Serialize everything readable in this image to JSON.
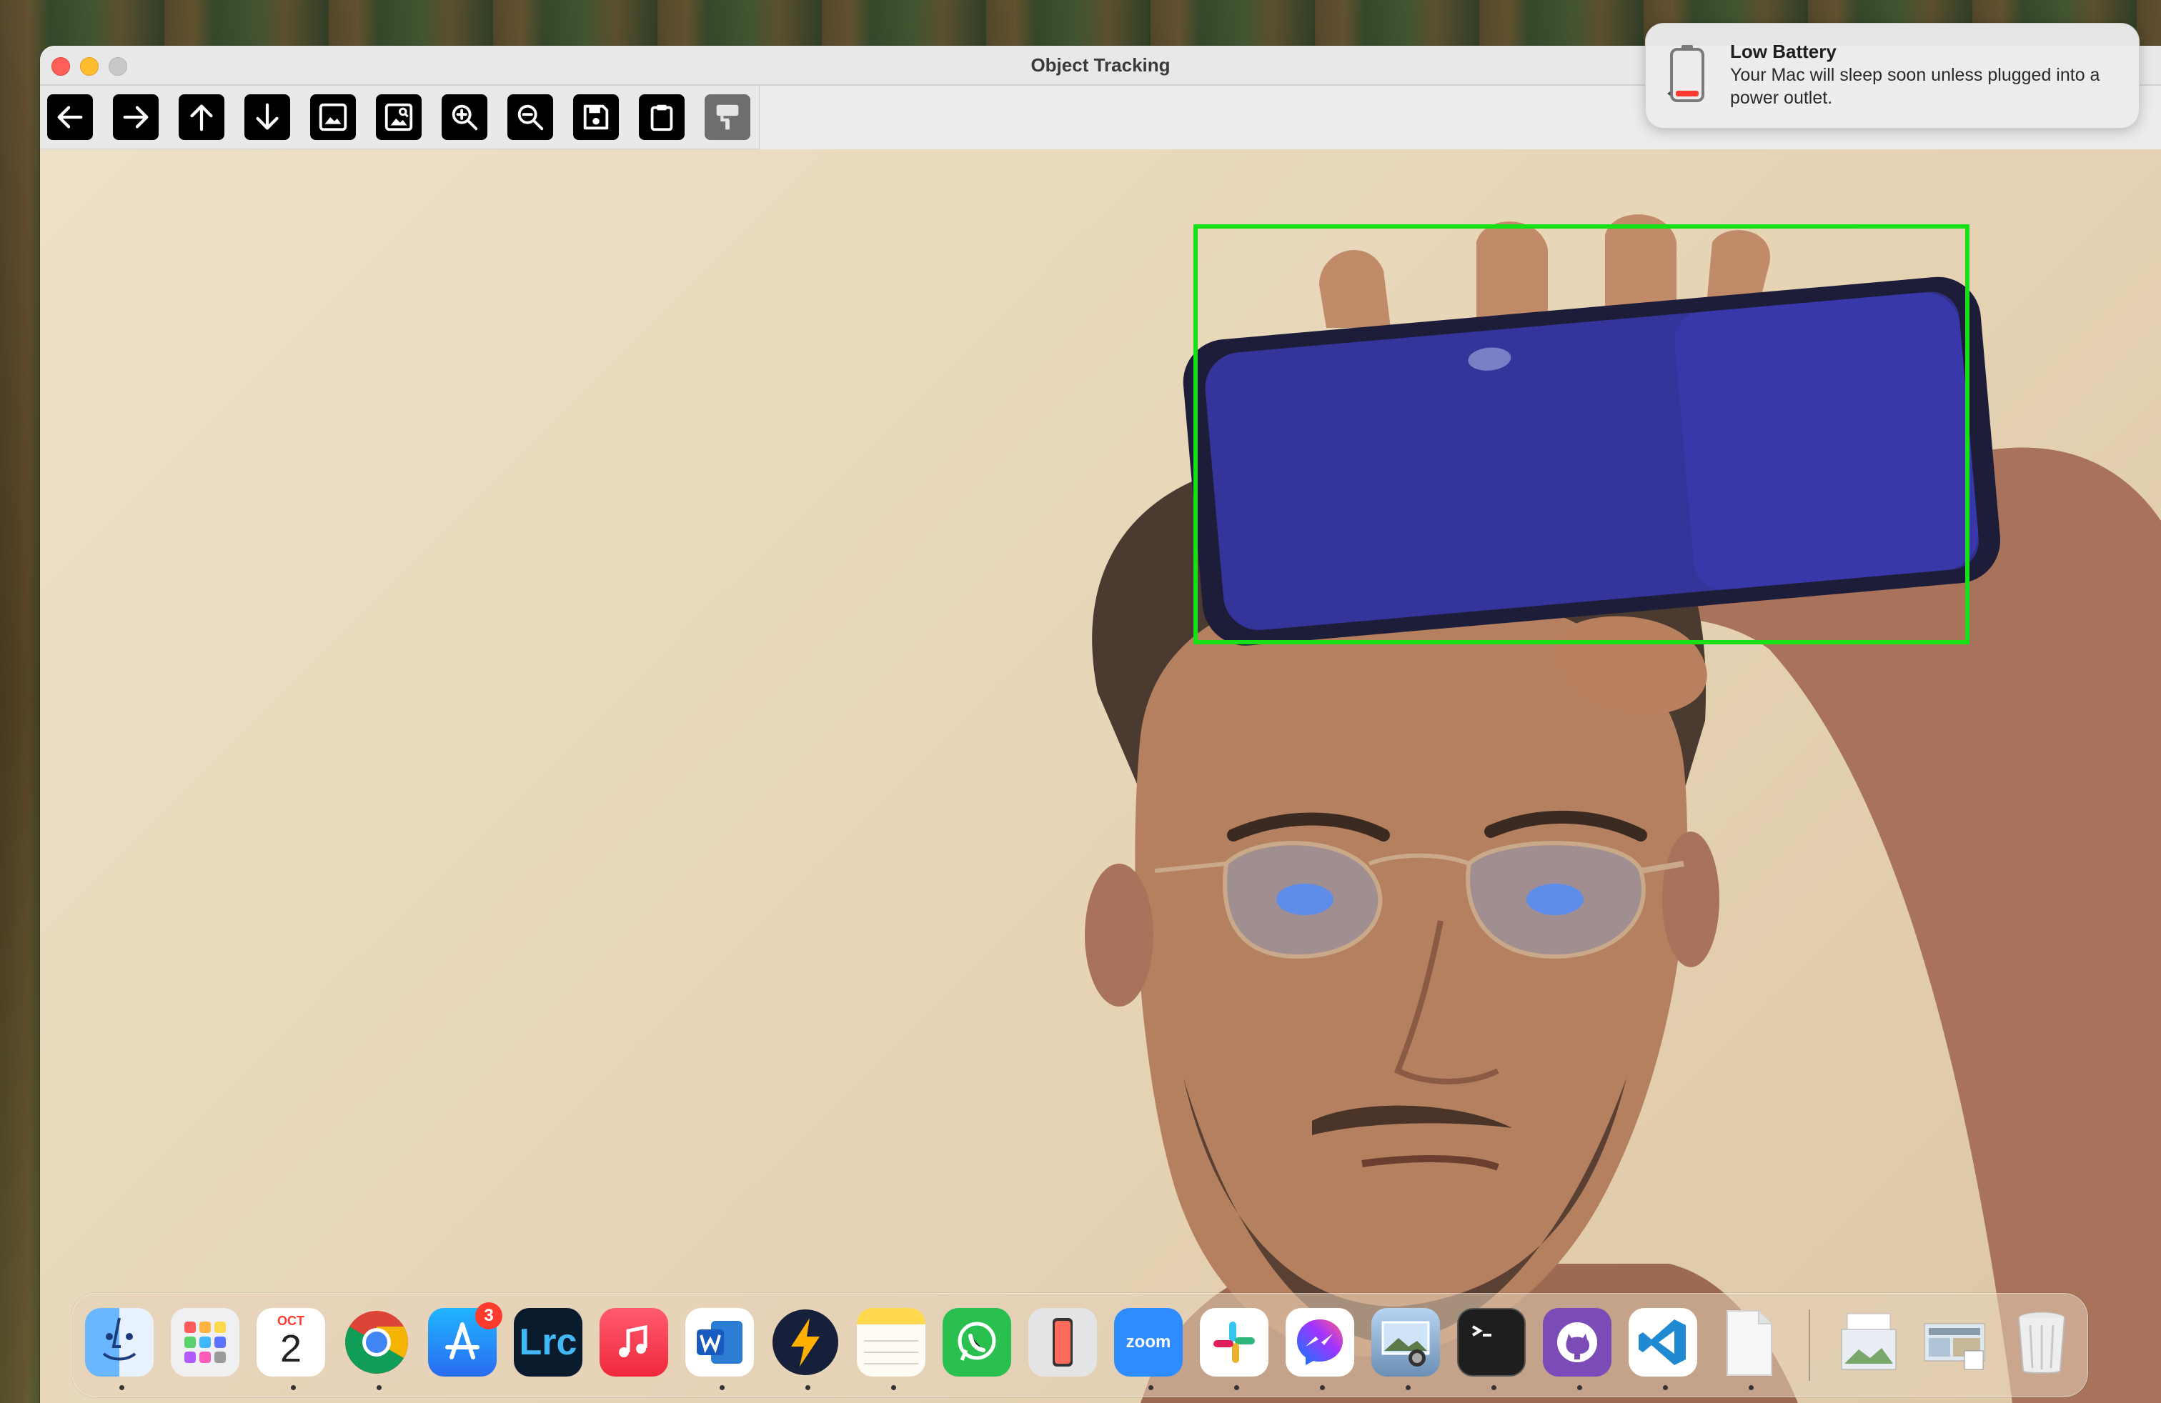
{
  "window": {
    "title": "Object Tracking"
  },
  "toolbar": {
    "buttons": [
      {
        "name": "back",
        "icon": "arrow-left-icon"
      },
      {
        "name": "forward",
        "icon": "arrow-right-icon"
      },
      {
        "name": "up",
        "icon": "arrow-up-icon"
      },
      {
        "name": "down",
        "icon": "arrow-down-icon"
      },
      {
        "name": "image",
        "icon": "image-icon"
      },
      {
        "name": "image-info",
        "icon": "image-search-icon"
      },
      {
        "name": "zoom-in",
        "icon": "zoom-in-icon"
      },
      {
        "name": "zoom-out",
        "icon": "zoom-out-icon"
      },
      {
        "name": "save",
        "icon": "save-icon"
      },
      {
        "name": "clipboard",
        "icon": "clipboard-icon"
      },
      {
        "name": "properties",
        "icon": "paint-roller-icon"
      }
    ]
  },
  "tracking": {
    "box_color": "#16e016"
  },
  "notification": {
    "title": "Low Battery",
    "body": "Your Mac will sleep soon unless plugged into a power outlet."
  },
  "dock": {
    "calendar_month": "OCT",
    "calendar_day": "2",
    "app_store_badge": "3",
    "lightroom_label": "Lrc",
    "zoom_label": "zoom",
    "apps": [
      "Finder",
      "Launchpad",
      "Calendar",
      "Chrome",
      "App Store",
      "Lightroom Classic",
      "Music",
      "Word",
      "Reeder",
      "Notes",
      "WhatsApp",
      "iPhone Mirroring",
      "Zoom",
      "Slack",
      "Messenger",
      "Preview",
      "Terminal",
      "GitHub Desktop",
      "Visual Studio Code",
      "Document",
      "Downloads",
      "Screenshots",
      "Trash"
    ]
  }
}
